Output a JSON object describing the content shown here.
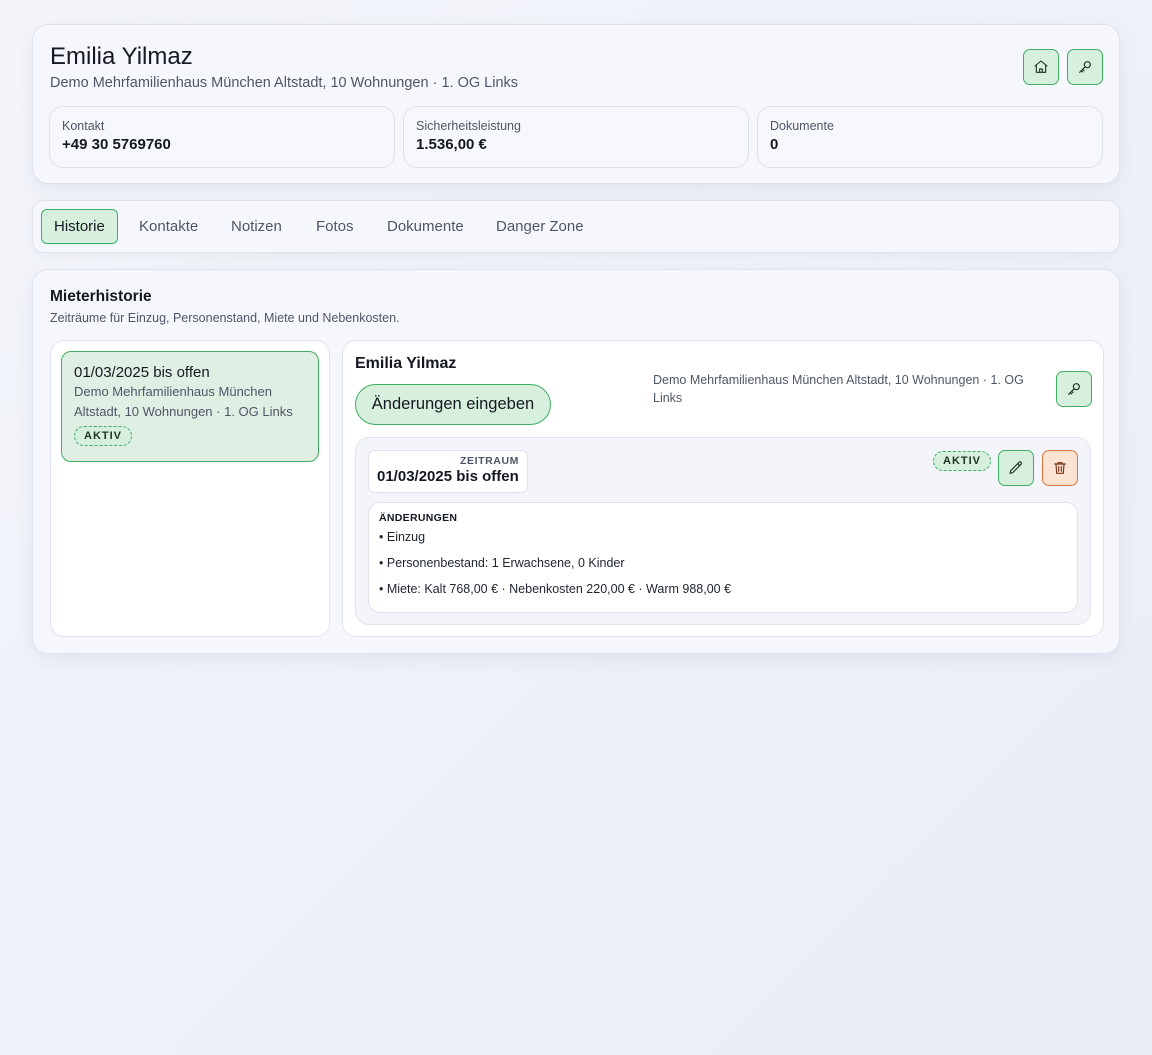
{
  "header": {
    "name": "Emilia Yilmaz",
    "address": "Demo Mehrfamilienhaus München Altstadt, 10 Wohnungen · 1. OG Links",
    "stats": [
      {
        "label": "Kontakt",
        "value": "+49 30 5769760"
      },
      {
        "label": "Sicherheitsleistung",
        "value": "1.536,00 €"
      },
      {
        "label": "Dokumente",
        "value": "0"
      }
    ],
    "icons": [
      "home-icon",
      "key-icon"
    ]
  },
  "tabs": [
    {
      "label": "Historie",
      "active": true
    },
    {
      "label": "Kontakte",
      "active": false
    },
    {
      "label": "Notizen",
      "active": false
    },
    {
      "label": "Fotos",
      "active": false
    },
    {
      "label": "Dokumente",
      "active": false
    },
    {
      "label": "Danger Zone",
      "active": false
    }
  ],
  "history": {
    "title": "Mieterhistorie",
    "subtitle": "Zeiträume für Einzug, Personenstand, Miete und Nebenkosten.",
    "list": [
      {
        "title": "01/03/2025 bis offen",
        "description": "Demo Mehrfamilienhaus München Altstadt, 10 Wohnungen · 1. OG Links",
        "badge": "AKTIV"
      }
    ],
    "detail": {
      "name": "Emilia Yilmaz",
      "change_button": "Änderungen eingeben",
      "address": "Demo Mehrfamilienhaus München Altstadt, 10 Wohnungen · 1. OG Links",
      "period": {
        "label": "ZEITRAUM",
        "value": "01/03/2025 bis offen",
        "badge": "AKTIV"
      },
      "changes": {
        "title": "ÄNDERUNGEN",
        "items": [
          "Einzug",
          "Personenbestand: 1 Erwachsene, 0 Kinder",
          "Miete: Kalt 768,00 € · Nebenkosten 220,00 € · Warm 988,00 €"
        ]
      }
    }
  },
  "colors": {
    "accent_green": "#3fae62",
    "accent_green_bg": "#d6f0dd",
    "danger_orange": "#d9753a",
    "danger_bg": "#fbe3d3"
  }
}
